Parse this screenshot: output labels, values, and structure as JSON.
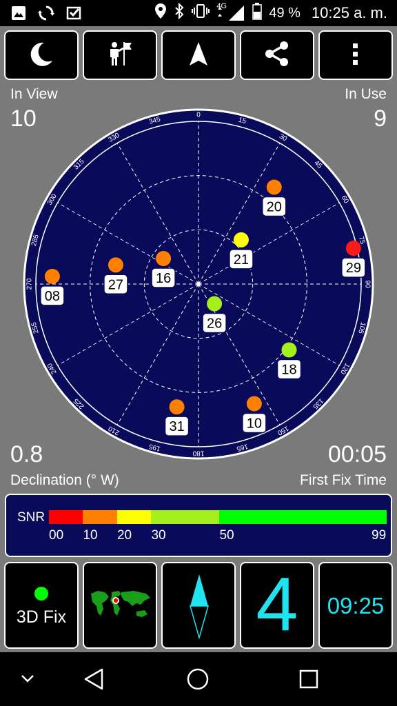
{
  "status": {
    "signal_type": "4G",
    "battery": "49 %",
    "time": "10:25 a. m.",
    "left_icons": [
      "image-icon",
      "sync-icon",
      "inbox-check-icon"
    ],
    "right_icons": [
      "location-icon",
      "bluetooth-icon",
      "vibrate-icon",
      "signal-icon",
      "battery-icon"
    ]
  },
  "toolbar": {
    "buttons": [
      {
        "name": "night-mode-button",
        "icon": "moon-icon"
      },
      {
        "name": "location-share-button",
        "icon": "person-flag-icon"
      },
      {
        "name": "navigation-button",
        "icon": "navigation-arrow-icon"
      },
      {
        "name": "share-button",
        "icon": "share-icon"
      },
      {
        "name": "more-options-button",
        "icon": "more-vertical-icon"
      }
    ]
  },
  "stats": {
    "in_view_label": "In View",
    "in_view_value": "10",
    "in_use_label": "In Use",
    "in_use_value": "9",
    "declination_value": "0.8",
    "declination_label": "Declination (° W)",
    "first_fix_value": "00:05",
    "first_fix_label": "First Fix Time"
  },
  "sky": {
    "azimuth_labels": [
      "0",
      "15",
      "30",
      "45",
      "60",
      "75",
      "90",
      "105",
      "120",
      "135",
      "150",
      "165",
      "180",
      "195",
      "210",
      "225",
      "240",
      "255",
      "270",
      "285",
      "300",
      "315",
      "330",
      "345"
    ],
    "satellites": [
      {
        "prn": "20",
        "azimuth": 38,
        "elevation": 22,
        "snr_color": "#ff8000"
      },
      {
        "prn": "29",
        "azimuth": 77,
        "elevation": 2,
        "snr_color": "#ff1a1a"
      },
      {
        "prn": "21",
        "azimuth": 44,
        "elevation": 56,
        "snr_color": "#ffff00"
      },
      {
        "prn": "16",
        "azimuth": 306,
        "elevation": 66,
        "snr_color": "#ff8000"
      },
      {
        "prn": "27",
        "azimuth": 283,
        "elevation": 43,
        "snr_color": "#ff8000"
      },
      {
        "prn": "08",
        "azimuth": 273,
        "elevation": 9,
        "snr_color": "#ff8000"
      },
      {
        "prn": "26",
        "azimuth": 141,
        "elevation": 76,
        "snr_color": "#a6ef1e"
      },
      {
        "prn": "18",
        "azimuth": 126,
        "elevation": 28,
        "snr_color": "#a6ef1e"
      },
      {
        "prn": "10",
        "azimuth": 155,
        "elevation": 17,
        "snr_color": "#ff8000"
      },
      {
        "prn": "31",
        "azimuth": 190,
        "elevation": 21,
        "snr_color": "#ff8000"
      }
    ]
  },
  "snr": {
    "label": "SNR",
    "ticks": [
      "00",
      "10",
      "20",
      "30",
      "50",
      "99"
    ],
    "colors": [
      "#ff0000",
      "#ff8000",
      "#ffff00",
      "#a6ef1e",
      "#00ff00"
    ]
  },
  "bottom": {
    "fix_label": "3D Fix",
    "fix_color": "#00ff00",
    "satellites_used": "4",
    "clock": "09:25",
    "accent": "#1fe4f0"
  },
  "navbar": {
    "icons": [
      "chevron-down-icon",
      "back-icon",
      "home-icon",
      "recents-icon"
    ]
  }
}
